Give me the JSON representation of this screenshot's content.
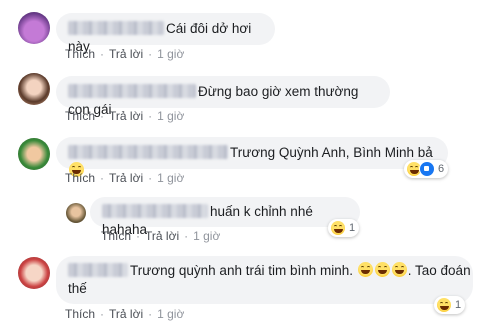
{
  "comments": [
    {
      "text": "Cái đôi dở hơi này",
      "actions": {
        "like": "Thích",
        "reply": "Trả lời",
        "time": "1 giờ"
      }
    },
    {
      "text": "Đừng bao giờ xem thường con gái",
      "actions": {
        "like": "Thích",
        "reply": "Trả lời",
        "time": "1 giờ"
      }
    },
    {
      "text": "Trương Quỳnh Anh, Bình Minh bả",
      "actions": {
        "like": "Thích",
        "reply": "Trả lời",
        "time": "1 giờ"
      },
      "reaction_count": "6"
    },
    {
      "text": "huấn k chỉnh nhé hahaha",
      "actions": {
        "like": "Thích",
        "reply": "Trả lời",
        "time": "1 giờ"
      },
      "reaction_count": "1"
    },
    {
      "text_line1": "Trương quỳnh anh trái tim bình minh.",
      "text_line1_tail": ". Tao đoán",
      "text_line2": "thế",
      "actions": {
        "like": "Thích",
        "reply": "Trả lời",
        "time": "1 giờ"
      },
      "reaction_count": "1"
    }
  ],
  "icons": [
    "laughing-emoji-icon",
    "like-reaction-icon"
  ],
  "colors": {
    "bubble": "#f2f3f5",
    "text": "#1c1e21",
    "meta": "#4b4f56",
    "like_blue": "#1877f2"
  }
}
